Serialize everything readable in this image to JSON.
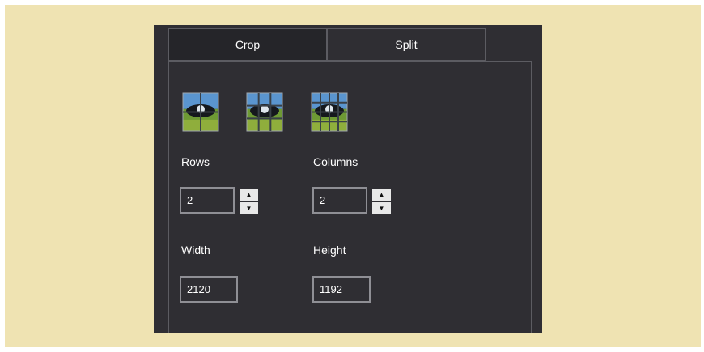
{
  "tabs": [
    {
      "label": "Crop",
      "active": true
    },
    {
      "label": "Split",
      "active": false
    }
  ],
  "layouts": [
    {
      "icon": "grid-2x2-icon",
      "rows": 2,
      "cols": 2
    },
    {
      "icon": "grid-3x3-icon",
      "rows": 3,
      "cols": 3
    },
    {
      "icon": "grid-4x4-icon",
      "rows": 4,
      "cols": 4
    }
  ],
  "rows": {
    "label": "Rows",
    "value": "2"
  },
  "columns": {
    "label": "Columns",
    "value": "2"
  },
  "width": {
    "label": "Width",
    "value": "2120"
  },
  "height": {
    "label": "Height",
    "value": "1192"
  },
  "colors": {
    "background": "#efe3b2",
    "panel": "#2f2e33",
    "active_tab": "#252529",
    "border": "#5c5c62",
    "text": "#ffffff"
  }
}
